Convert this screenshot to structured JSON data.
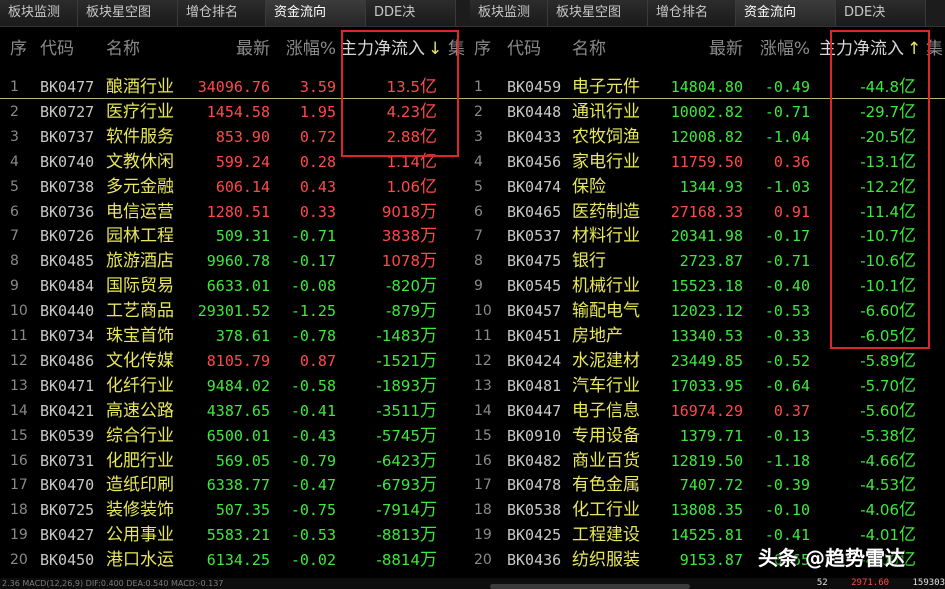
{
  "left": {
    "tabs": [
      {
        "label": "板块监测",
        "active": false
      },
      {
        "label": "板块星空图",
        "active": false
      },
      {
        "label": "增仓排名",
        "active": false
      },
      {
        "label": "资金流向",
        "active": true
      },
      {
        "label": "DDE决",
        "active": false
      }
    ],
    "headers": {
      "idx": "序",
      "code": "代码",
      "name": "名称",
      "price": "最新",
      "change": "涨幅%",
      "flow": "主力净流入",
      "sort_arrow": "↓",
      "extra": "集"
    },
    "rows": [
      {
        "idx": "1",
        "code": "BK0477",
        "name": "酿酒行业",
        "price": "34096.76",
        "chg": "3.59",
        "flow": "13.5",
        "unit": "亿",
        "dir": "up",
        "fdir": "up"
      },
      {
        "idx": "2",
        "code": "BK0727",
        "name": "医疗行业",
        "price": "1454.58",
        "chg": "1.95",
        "flow": "4.23",
        "unit": "亿",
        "dir": "up",
        "fdir": "up"
      },
      {
        "idx": "3",
        "code": "BK0737",
        "name": "软件服务",
        "price": "853.90",
        "chg": "0.72",
        "flow": "2.88",
        "unit": "亿",
        "dir": "up",
        "fdir": "up"
      },
      {
        "idx": "4",
        "code": "BK0740",
        "name": "文教休闲",
        "price": "599.24",
        "chg": "0.28",
        "flow": "1.14",
        "unit": "亿",
        "dir": "up",
        "fdir": "up"
      },
      {
        "idx": "5",
        "code": "BK0738",
        "name": "多元金融",
        "price": "606.14",
        "chg": "0.43",
        "flow": "1.06",
        "unit": "亿",
        "dir": "up",
        "fdir": "up"
      },
      {
        "idx": "6",
        "code": "BK0736",
        "name": "电信运营",
        "price": "1280.51",
        "chg": "0.33",
        "flow": "9018",
        "unit": "万",
        "dir": "up",
        "fdir": "up"
      },
      {
        "idx": "7",
        "code": "BK0726",
        "name": "园林工程",
        "price": "509.31",
        "chg": "-0.71",
        "flow": "3838",
        "unit": "万",
        "dir": "down",
        "fdir": "up"
      },
      {
        "idx": "8",
        "code": "BK0485",
        "name": "旅游酒店",
        "price": "9960.78",
        "chg": "-0.17",
        "flow": "1078",
        "unit": "万",
        "dir": "down",
        "fdir": "up"
      },
      {
        "idx": "9",
        "code": "BK0484",
        "name": "国际贸易",
        "price": "6633.01",
        "chg": "-0.08",
        "flow": "-820",
        "unit": "万",
        "dir": "down",
        "fdir": "down"
      },
      {
        "idx": "10",
        "code": "BK0440",
        "name": "工艺商品",
        "price": "29301.52",
        "chg": "-1.25",
        "flow": "-879",
        "unit": "万",
        "dir": "down",
        "fdir": "down"
      },
      {
        "idx": "11",
        "code": "BK0734",
        "name": "珠宝首饰",
        "price": "378.61",
        "chg": "-0.78",
        "flow": "-1483",
        "unit": "万",
        "dir": "down",
        "fdir": "down"
      },
      {
        "idx": "12",
        "code": "BK0486",
        "name": "文化传媒",
        "price": "8105.79",
        "chg": "0.87",
        "flow": "-1521",
        "unit": "万",
        "dir": "up",
        "fdir": "down"
      },
      {
        "idx": "13",
        "code": "BK0471",
        "name": "化纤行业",
        "price": "9484.02",
        "chg": "-0.58",
        "flow": "-1893",
        "unit": "万",
        "dir": "down",
        "fdir": "down"
      },
      {
        "idx": "14",
        "code": "BK0421",
        "name": "高速公路",
        "price": "4387.65",
        "chg": "-0.41",
        "flow": "-3511",
        "unit": "万",
        "dir": "down",
        "fdir": "down"
      },
      {
        "idx": "15",
        "code": "BK0539",
        "name": "综合行业",
        "price": "6500.01",
        "chg": "-0.43",
        "flow": "-5745",
        "unit": "万",
        "dir": "down",
        "fdir": "down"
      },
      {
        "idx": "16",
        "code": "BK0731",
        "name": "化肥行业",
        "price": "569.05",
        "chg": "-0.79",
        "flow": "-6423",
        "unit": "万",
        "dir": "down",
        "fdir": "down"
      },
      {
        "idx": "17",
        "code": "BK0470",
        "name": "造纸印刷",
        "price": "6338.77",
        "chg": "-0.47",
        "flow": "-6793",
        "unit": "万",
        "dir": "down",
        "fdir": "down"
      },
      {
        "idx": "18",
        "code": "BK0725",
        "name": "装修装饰",
        "price": "507.35",
        "chg": "-0.75",
        "flow": "-7914",
        "unit": "万",
        "dir": "down",
        "fdir": "down"
      },
      {
        "idx": "19",
        "code": "BK0427",
        "name": "公用事业",
        "price": "5583.21",
        "chg": "-0.53",
        "flow": "-8813",
        "unit": "万",
        "dir": "down",
        "fdir": "down"
      },
      {
        "idx": "20",
        "code": "BK0450",
        "name": "港口水运",
        "price": "6134.25",
        "chg": "-0.02",
        "flow": "-8814",
        "unit": "万",
        "dir": "down",
        "fdir": "down"
      }
    ],
    "status": "2.36   MACD(12,26,9)  DIF:0.400  DEA:0.540  MACD:-0.137"
  },
  "right": {
    "tabs": [
      {
        "label": "板块监测",
        "active": false
      },
      {
        "label": "板块星空图",
        "active": false
      },
      {
        "label": "增仓排名",
        "active": false
      },
      {
        "label": "资金流向",
        "active": true
      },
      {
        "label": "DDE决",
        "active": false
      }
    ],
    "headers": {
      "idx": "序",
      "code": "代码",
      "name": "名称",
      "price": "最新",
      "change": "涨幅%",
      "flow": "主力净流入",
      "sort_arrow": "↑",
      "extra": "集"
    },
    "rows": [
      {
        "idx": "1",
        "code": "BK0459",
        "name": "电子元件",
        "price": "14804.80",
        "chg": "-0.49",
        "flow": "-44.8",
        "unit": "亿",
        "dir": "down",
        "fdir": "down"
      },
      {
        "idx": "2",
        "code": "BK0448",
        "name": "通讯行业",
        "price": "10002.82",
        "chg": "-0.71",
        "flow": "-29.7",
        "unit": "亿",
        "dir": "down",
        "fdir": "down"
      },
      {
        "idx": "3",
        "code": "BK0433",
        "name": "农牧饲渔",
        "price": "12008.82",
        "chg": "-1.04",
        "flow": "-20.5",
        "unit": "亿",
        "dir": "down",
        "fdir": "down"
      },
      {
        "idx": "4",
        "code": "BK0456",
        "name": "家电行业",
        "price": "11759.50",
        "chg": "0.36",
        "flow": "-13.1",
        "unit": "亿",
        "dir": "up",
        "fdir": "down"
      },
      {
        "idx": "5",
        "code": "BK0474",
        "name": "保险",
        "price": "1344.93",
        "chg": "-1.03",
        "flow": "-12.2",
        "unit": "亿",
        "dir": "down",
        "fdir": "down"
      },
      {
        "idx": "6",
        "code": "BK0465",
        "name": "医药制造",
        "price": "27168.33",
        "chg": "0.91",
        "flow": "-11.4",
        "unit": "亿",
        "dir": "up",
        "fdir": "down"
      },
      {
        "idx": "7",
        "code": "BK0537",
        "name": "材料行业",
        "price": "20341.98",
        "chg": "-0.17",
        "flow": "-10.7",
        "unit": "亿",
        "dir": "down",
        "fdir": "down"
      },
      {
        "idx": "8",
        "code": "BK0475",
        "name": "银行",
        "price": "2723.87",
        "chg": "-0.71",
        "flow": "-10.6",
        "unit": "亿",
        "dir": "down",
        "fdir": "down"
      },
      {
        "idx": "9",
        "code": "BK0545",
        "name": "机械行业",
        "price": "15523.18",
        "chg": "-0.40",
        "flow": "-10.1",
        "unit": "亿",
        "dir": "down",
        "fdir": "down"
      },
      {
        "idx": "10",
        "code": "BK0457",
        "name": "输配电气",
        "price": "12023.12",
        "chg": "-0.53",
        "flow": "-6.60",
        "unit": "亿",
        "dir": "down",
        "fdir": "down"
      },
      {
        "idx": "11",
        "code": "BK0451",
        "name": "房地产",
        "price": "13340.53",
        "chg": "-0.33",
        "flow": "-6.05",
        "unit": "亿",
        "dir": "down",
        "fdir": "down"
      },
      {
        "idx": "12",
        "code": "BK0424",
        "name": "水泥建材",
        "price": "23449.85",
        "chg": "-0.52",
        "flow": "-5.89",
        "unit": "亿",
        "dir": "down",
        "fdir": "down"
      },
      {
        "idx": "13",
        "code": "BK0481",
        "name": "汽车行业",
        "price": "17033.95",
        "chg": "-0.64",
        "flow": "-5.70",
        "unit": "亿",
        "dir": "down",
        "fdir": "down"
      },
      {
        "idx": "14",
        "code": "BK0447",
        "name": "电子信息",
        "price": "16974.29",
        "chg": "0.37",
        "flow": "-5.60",
        "unit": "亿",
        "dir": "up",
        "fdir": "down"
      },
      {
        "idx": "15",
        "code": "BK0910",
        "name": "专用设备",
        "price": "1379.71",
        "chg": "-0.13",
        "flow": "-5.38",
        "unit": "亿",
        "dir": "down",
        "fdir": "down"
      },
      {
        "idx": "16",
        "code": "BK0482",
        "name": "商业百货",
        "price": "12819.50",
        "chg": "-1.18",
        "flow": "-4.66",
        "unit": "亿",
        "dir": "down",
        "fdir": "down"
      },
      {
        "idx": "17",
        "code": "BK0478",
        "name": "有色金属",
        "price": "7407.72",
        "chg": "-0.39",
        "flow": "-4.53",
        "unit": "亿",
        "dir": "down",
        "fdir": "down"
      },
      {
        "idx": "18",
        "code": "BK0538",
        "name": "化工行业",
        "price": "13808.35",
        "chg": "-0.10",
        "flow": "-4.06",
        "unit": "亿",
        "dir": "down",
        "fdir": "down"
      },
      {
        "idx": "19",
        "code": "BK0425",
        "name": "工程建设",
        "price": "14525.81",
        "chg": "-0.41",
        "flow": "-4.01",
        "unit": "亿",
        "dir": "down",
        "fdir": "down"
      },
      {
        "idx": "20",
        "code": "BK0436",
        "name": "纺织服装",
        "price": "9153.87",
        "chg": "-0.65",
        "flow": "-4.00",
        "unit": "亿",
        "dir": "down",
        "fdir": "down"
      }
    ],
    "status_a": "52",
    "status_b": "2971.60",
    "status_c": "159303"
  },
  "watermark": "头条 @趋势雷达",
  "colors": {
    "up": "#ff4a4a",
    "down": "#3ee83e",
    "name": "#e8e65a",
    "highlight": "#e0252a",
    "bg": "#000000"
  }
}
